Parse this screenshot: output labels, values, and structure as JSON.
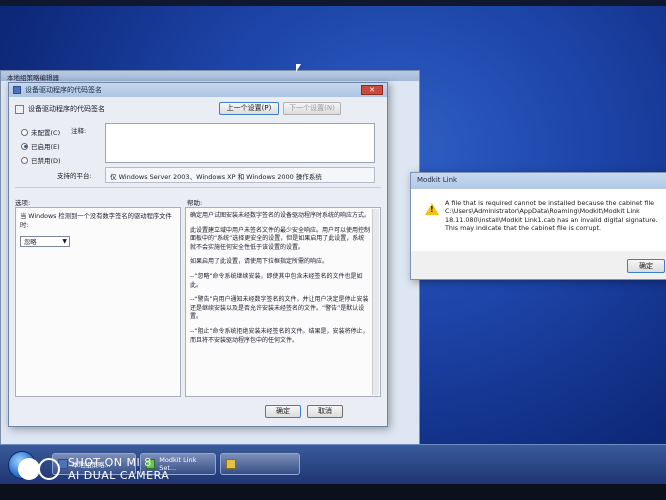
{
  "background_window": {
    "title": "本地组策略编辑器"
  },
  "policy_dialog": {
    "title": "设备驱动程序的代码签名",
    "policy_name": "设备驱动程序的代码签名",
    "prev_button": "上一个设置(P)",
    "next_button": "下一个设置(N)",
    "radio_not_configured": "未配置(C)",
    "radio_enabled": "已启用(E)",
    "radio_disabled": "已禁用(D)",
    "comment_label": "注释:",
    "platform_label": "支持的平台:",
    "platform_value": "仅 Windows Server 2003、Windows XP 和 Windows 2000 操作系统",
    "options_label": "选项:",
    "help_label": "帮助:",
    "option_description": "当 Windows 检测到一个没有数字签名的驱动程序文件时:",
    "option_selected": "忽略",
    "help_paragraphs": [
      "确定用户试图安装未经数字签名的设备驱动程序时系统的响应方式。",
      "此设置建立域中用户未签名文件的最少安全响应。用户可以使用控制面板中的“系统”选择更安全的设置，但是如果启用了此设置，系统就不会实施任何安全性低于该设置的设置。",
      "如果启用了此设置，请使用下拉框指定所需的响应。",
      "--“忽略”命令系统继续安装，即使其中包含未经签名的文件也是如此。",
      "--“警告”向用户通知未经数字签名的文件，并让用户决定是停止安装还是继续安装以及是否允许安装未经签名的文件。“警告”是默认设置。",
      "--“阻止”命令系统拒绝安装未经签名的文件。结果是，安装将停止，而且将不安装驱动程序包中的任何文件。"
    ],
    "ok_button": "确定",
    "cancel_button": "取消"
  },
  "modkit_dialog": {
    "title": "Modkit Link",
    "message": "A file that is required cannot be installed because the cabinet file C:\\Users\\Administrator\\AppData\\Roaming\\Modkit\\Modkit Link 18.11.080\\install\\Modkit Link1.cab has an invalid digital signature.  This may indicate that the cabinet file is corrupt.",
    "ok_button": "确定"
  },
  "taskbar": {
    "items": [
      {
        "label": "本地组策略..."
      },
      {
        "label": "Modkit Link Set..."
      },
      {
        "label": ""
      }
    ]
  },
  "watermark": {
    "line1": "SHOT ON MI 8",
    "line2": "AI DUAL CAMERA"
  },
  "colors": {
    "desktop": "#1d44a8",
    "warning": "#f2c21b",
    "accent": "#3c7fc8"
  }
}
